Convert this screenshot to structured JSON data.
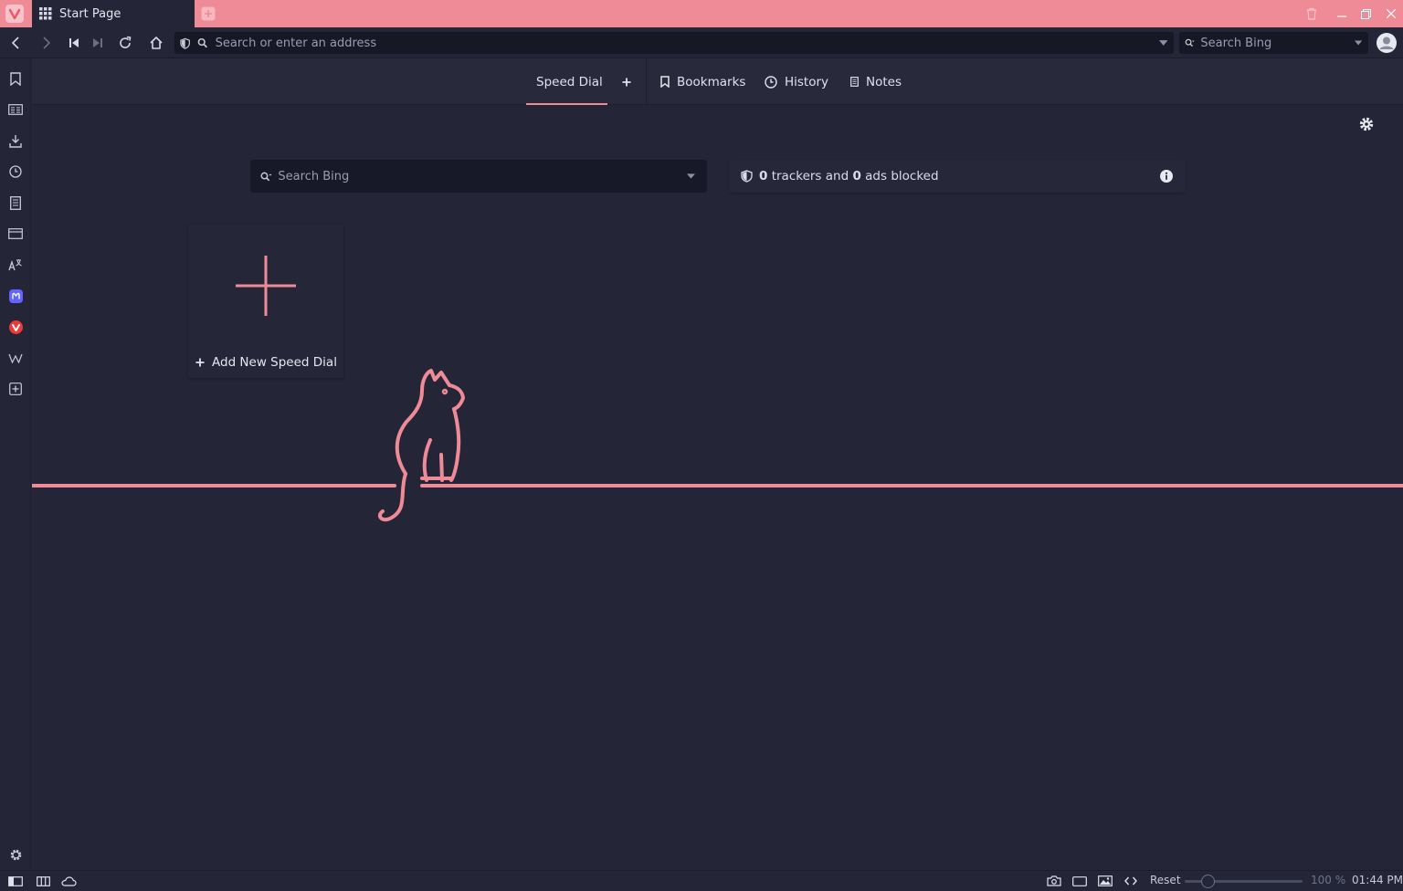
{
  "colors": {
    "accent": "#ef8a97",
    "background": "#242638",
    "field": "#161826"
  },
  "tab": {
    "title": "Start Page",
    "icon": "grid-icon"
  },
  "address_bar": {
    "placeholder": "Search or enter an address"
  },
  "search_engine": {
    "placeholder": "Search Bing"
  },
  "start_nav": {
    "speed_dial": "Speed Dial",
    "bookmarks": "Bookmarks",
    "history": "History",
    "notes": "Notes"
  },
  "page_search": {
    "placeholder": "Search Bing"
  },
  "blocker": {
    "trackers": "0",
    "trackers_label": " trackers and ",
    "ads": "0",
    "ads_label": " ads blocked"
  },
  "speed_dial_card": {
    "label": "Add New Speed Dial"
  },
  "status": {
    "reset": "Reset",
    "zoom": "100 %",
    "time": "01:44 PM"
  }
}
